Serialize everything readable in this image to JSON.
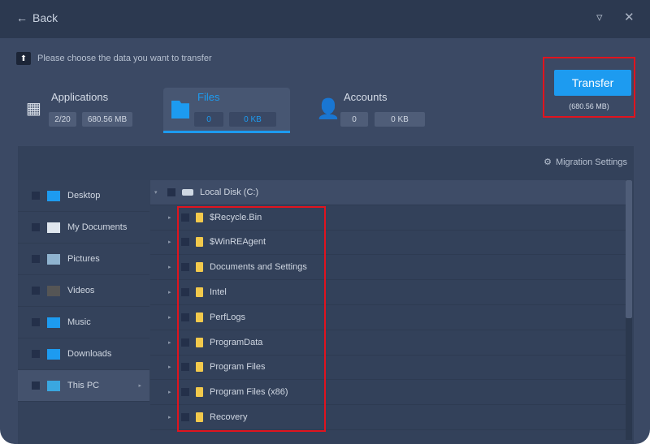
{
  "topbar": {
    "back_label": "Back"
  },
  "prompt": "Please choose the data you want to transfer",
  "categories": {
    "applications": {
      "title": "Applications",
      "count": "2/20",
      "size": "680.56 MB"
    },
    "files": {
      "title": "Files",
      "count": "0",
      "size": "0 KB"
    },
    "accounts": {
      "title": "Accounts",
      "count": "0",
      "size": "0 KB"
    }
  },
  "transfer": {
    "label": "Transfer",
    "size": "(680.56 MB)"
  },
  "migration_settings": "Migration Settings",
  "left_items": [
    {
      "label": "Desktop"
    },
    {
      "label": "My Documents"
    },
    {
      "label": "Pictures"
    },
    {
      "label": "Videos"
    },
    {
      "label": "Music"
    },
    {
      "label": "Downloads"
    },
    {
      "label": "This PC"
    }
  ],
  "tree": {
    "root": "Local Disk (C:)",
    "children": [
      "$Recycle.Bin",
      "$WinREAgent",
      "Documents and Settings",
      "Intel",
      "PerfLogs",
      "ProgramData",
      "Program Files",
      "Program Files (x86)",
      "Recovery"
    ]
  }
}
